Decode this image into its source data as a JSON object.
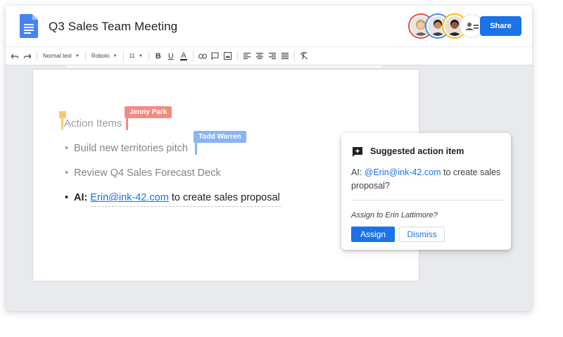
{
  "document": {
    "title": "Q3 Sales Team Meeting",
    "share_label": "Share"
  },
  "collaborators": [
    {
      "name": "avatar-1",
      "ring_color": "#ea4335",
      "skin": "#f1c9a5",
      "hair": "#c9a26b"
    },
    {
      "name": "avatar-2",
      "ring_color": "#4285f4",
      "skin": "#c58c62",
      "hair": "#2b1d14"
    },
    {
      "name": "avatar-3",
      "ring_color": "#fbbc04",
      "skin": "#8d5a3b",
      "hair": "#1c120c"
    },
    {
      "name": "more-collaborators",
      "ring_color": "#dadce0",
      "icon": "people-icon"
    }
  ],
  "toolbar": {
    "style_label": "Normal text",
    "font_label": "Roboto",
    "size_label": "11",
    "bold_label": "B",
    "underline_label": "U",
    "textcolor_label": "A"
  },
  "content": {
    "heading": "Action Items",
    "bullets": [
      "Build new territories pitch",
      "Review Q4 Sales Forecast Deck"
    ],
    "ai_prefix": "AI:",
    "ai_link": "Erin@ink-42.com",
    "ai_suffix": "to create sales proposal"
  },
  "cursors": [
    {
      "name": "Jenny Park",
      "color": "#f28b82"
    },
    {
      "name": "Todd Warren",
      "color": "#8ab4f8"
    }
  ],
  "suggestion": {
    "title": "Suggested action item",
    "body_prefix": "AI: ",
    "mention": "@Erin@ink-42.com",
    "body_suffix": " to create sales proposal?",
    "question": "Assign to Erin Lattimore?",
    "assign_label": "Assign",
    "dismiss_label": "Dismiss"
  },
  "colors": {
    "accent": "#1a73e8",
    "jenny": "#f28b82",
    "todd": "#8ab4f8",
    "marker": "#f7cb6b"
  }
}
